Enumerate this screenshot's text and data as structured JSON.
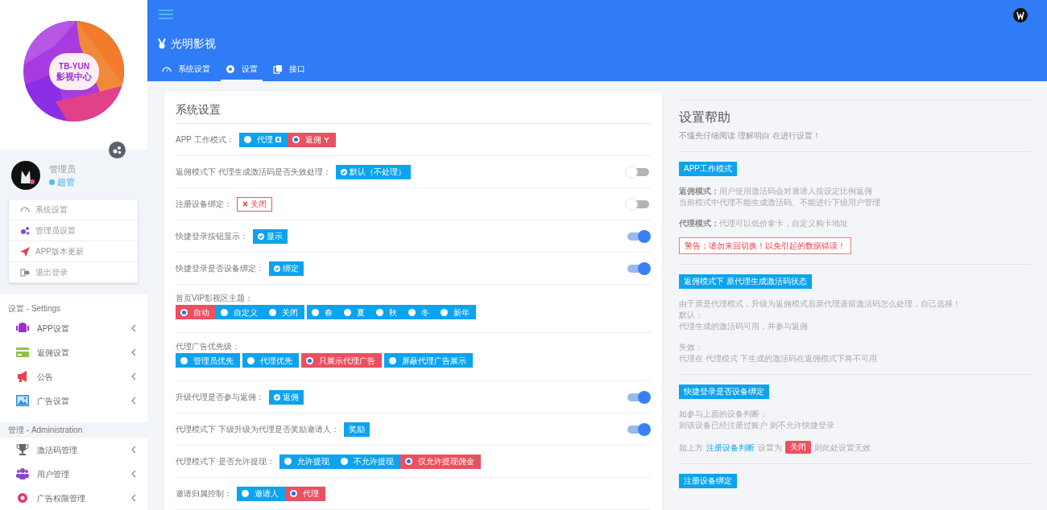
{
  "sidebar": {
    "logo": {
      "line_1": "TB-YUN",
      "line_2": "影视中心"
    },
    "user": {
      "name": "管理员",
      "role": "超管"
    },
    "quick_menu": [
      "系统设置",
      "管理员设置",
      "APP版本更新",
      "退出登录"
    ],
    "sections": [
      {
        "title": "设置 - Settings",
        "items": [
          "APP设置",
          "返佣设置",
          "公告",
          "广告设置"
        ]
      },
      {
        "title": "管理 - Administration",
        "items": [
          "激活码管理",
          "用户管理",
          "广告权限管理"
        ]
      }
    ]
  },
  "header": {
    "brand": "光明影视",
    "tabs": [
      {
        "label": "系统设置",
        "selected": false
      },
      {
        "label": "设置",
        "selected": true
      },
      {
        "label": "接口",
        "selected": false
      }
    ]
  },
  "settings": {
    "title": "系统设置",
    "rows": [
      {
        "label": "APP 工作模式：",
        "kind": "radio",
        "groups": [
          [
            {
              "label": "代理",
              "kind": "card",
              "selected": false
            },
            {
              "label": "返佣",
              "kind": "branch",
              "selected": true
            }
          ]
        ]
      },
      {
        "label": "返佣模式下 代理生成激活码是否失效处理：",
        "kind": "badge",
        "badge": {
          "text": "默认（不处理）",
          "kind": "confirm"
        },
        "switch": {
          "on": false
        }
      },
      {
        "label": "注册设备绑定：",
        "kind": "badge",
        "badge": {
          "text": "关闭",
          "kind": "off"
        },
        "switch": {
          "on": false
        }
      },
      {
        "label": "快捷登录按钮显示：",
        "kind": "badge",
        "badge": {
          "text": "显示",
          "kind": "confirm"
        },
        "switch": {
          "on": true
        }
      },
      {
        "label": "快捷登录是否设备绑定：",
        "kind": "badge",
        "badge": {
          "text": "绑定",
          "kind": "confirm"
        },
        "switch": {
          "on": true
        }
      },
      {
        "label": "首页VIP影视区主题：",
        "kind": "radio-stacked",
        "groups": [
          [
            {
              "label": "自动",
              "kind": "plain",
              "selected": true
            },
            {
              "label": "自定义",
              "kind": "plain",
              "selected": false
            },
            {
              "label": "关闭",
              "kind": "plain",
              "selected": false
            }
          ],
          [
            {
              "label": "春",
              "kind": "plain",
              "selected": false
            },
            {
              "label": "夏",
              "kind": "plain",
              "selected": false
            },
            {
              "label": "秋",
              "kind": "plain",
              "selected": false
            },
            {
              "label": "冬",
              "kind": "plain",
              "selected": false
            },
            {
              "label": "新年",
              "kind": "plain",
              "selected": false
            }
          ]
        ]
      },
      {
        "label": "代理广告优先级：",
        "kind": "radio-stacked",
        "groups": [
          [
            {
              "label": "管理员优先",
              "kind": "plain",
              "selected": false
            }
          ],
          [
            {
              "label": "代理优先",
              "kind": "plain",
              "selected": false
            }
          ],
          [
            {
              "label": "只展示代理广告",
              "kind": "plain",
              "selected": true
            }
          ],
          [
            {
              "label": "屏蔽代理广告展示",
              "kind": "plain",
              "selected": false
            }
          ]
        ]
      },
      {
        "label": "升级代理是否参与返佣：",
        "kind": "badge",
        "badge": {
          "text": "返佣",
          "kind": "confirm"
        },
        "switch": {
          "on": true
        }
      },
      {
        "label": "代理模式下 下级升级为代理是否奖励邀请人：",
        "kind": "badge",
        "badge": {
          "text": "奖励",
          "kind": "plain"
        },
        "switch": {
          "on": true
        }
      },
      {
        "label": "代理模式下 是否允许提现：",
        "kind": "radio",
        "groups": [
          [
            {
              "label": "允许提现",
              "kind": "plain",
              "selected": false
            },
            {
              "label": "不允许提现",
              "kind": "plain",
              "selected": false
            },
            {
              "label": "仅允许提现佣金",
              "kind": "plain",
              "selected": true
            }
          ]
        ]
      },
      {
        "label": "邀请归属控制：",
        "kind": "radio",
        "groups": [
          [
            {
              "label": "邀请人",
              "kind": "plain",
              "selected": false
            },
            {
              "label": "代理",
              "kind": "plain",
              "selected": true
            }
          ]
        ]
      }
    ]
  },
  "help": {
    "title": "设置帮助",
    "subtitle": "不懂先仔细阅读 理解明白 在进行设置！",
    "sections": [
      {
        "tag": "APP工作模式",
        "blocks": [
          {
            "kind": "text",
            "lines": [
              "**返佣模式：**用户使用激活码会对邀请人按设定比例返佣",
              "当前模式中代理不能生成激活码、不能进行下级用户管理"
            ]
          },
          {
            "kind": "text",
            "lines": [
              "**代理模式：**代理可以低价拿卡，自定义购卡地址"
            ]
          },
          {
            "kind": "alert",
            "text": "警告：请勿来回切换！以免引起的数据错误！"
          }
        ]
      },
      {
        "tag": "返佣模式下 原代理生成激活码状态",
        "blocks": [
          {
            "kind": "text",
            "lines": [
              "由于原是代理模式，升级为返佣模式后原代理遗留激活码怎么处理，自己选择！",
              "默认：",
              "代理生成的激活码可用，并参与返佣"
            ]
          },
          {
            "kind": "text",
            "lines": [
              "失效：",
              "代理在 代理模式 下生成的激活码在返佣模式下将不可用"
            ]
          }
        ]
      },
      {
        "tag": "快捷登录是否设备绑定",
        "blocks": [
          {
            "kind": "text",
            "lines": [
              "如参与上面的设备判断：",
              "则该设备已经注册过账户 则不允许快捷登录"
            ]
          },
          {
            "kind": "mixed",
            "segments": [
              {
                "kind": "text",
                "text": "如上方"
              },
              {
                "kind": "link",
                "text": "注册设备判断"
              },
              {
                "kind": "text",
                "text": "设置为"
              },
              {
                "kind": "badge",
                "text": "关闭"
              },
              {
                "kind": "text",
                "text": "则此处设置无效"
              }
            ]
          }
        ]
      },
      {
        "tag": "注册设备绑定"
      }
    ]
  }
}
